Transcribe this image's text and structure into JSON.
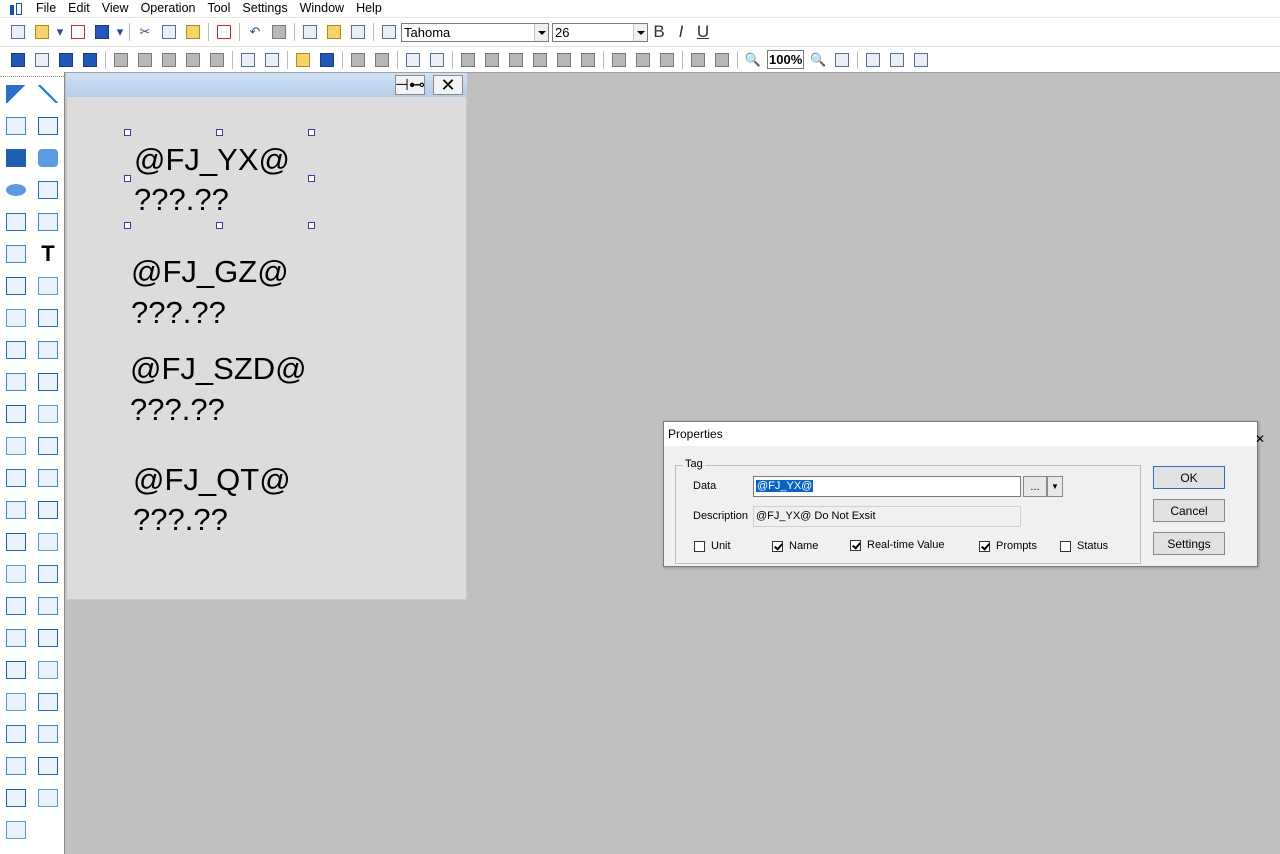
{
  "menu": [
    "File",
    "Edit",
    "View",
    "Operation",
    "Tool",
    "Settings",
    "Window",
    "Help"
  ],
  "toolbar": {
    "font_name": "Tahoma",
    "font_size": "26",
    "bold_label": "B",
    "italic_label": "I",
    "underline_label": "U",
    "zoom": "100%"
  },
  "canvas": {
    "pin_label": "⊣⊷",
    "close_label": "✕",
    "items": [
      {
        "tag": "@FJ_YX@",
        "value": "???.??"
      },
      {
        "tag": "@FJ_GZ@",
        "value": "???.??"
      },
      {
        "tag": "@FJ_SZD@",
        "value": "???.??"
      },
      {
        "tag": "@FJ_QT@",
        "value": "???.??"
      }
    ]
  },
  "dialog": {
    "title": "Properties",
    "close_label": "✕",
    "group_label": "Tag",
    "data_label": "Data",
    "data_value": "@FJ_YX@",
    "browse_label": "...",
    "description_label": "Description",
    "description_value": "@FJ_YX@ Do Not Exsit",
    "checkboxes": [
      {
        "label": "Unit",
        "checked": false
      },
      {
        "label": "Name",
        "checked": true
      },
      {
        "label": "Real-time Value",
        "checked": true
      },
      {
        "label": "Prompts",
        "checked": true
      },
      {
        "label": "Status",
        "checked": false
      }
    ],
    "ok_label": "OK",
    "cancel_label": "Cancel",
    "settings_label": "Settings"
  }
}
